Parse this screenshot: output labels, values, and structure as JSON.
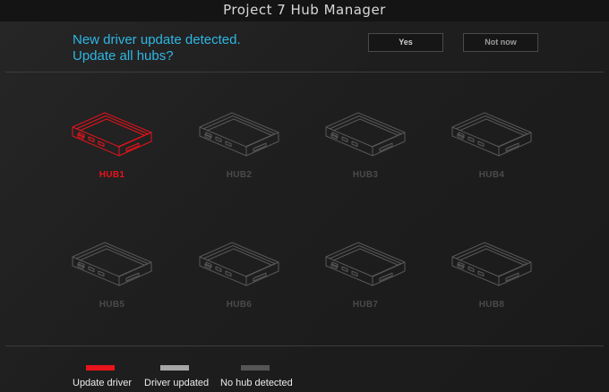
{
  "window": {
    "title": "Project 7 Hub Manager"
  },
  "prompt": {
    "line1": "New driver update detected.",
    "line2": "Update all hubs?",
    "yes_label": "Yes",
    "not_now_label": "Not now"
  },
  "hubs": [
    {
      "label": "HUB1",
      "status": "update"
    },
    {
      "label": "HUB2",
      "status": "none"
    },
    {
      "label": "HUB3",
      "status": "none"
    },
    {
      "label": "HUB4",
      "status": "none"
    },
    {
      "label": "HUB5",
      "status": "none"
    },
    {
      "label": "HUB6",
      "status": "none"
    },
    {
      "label": "HUB7",
      "status": "none"
    },
    {
      "label": "HUB8",
      "status": "none"
    }
  ],
  "legend": [
    {
      "label": "Update driver",
      "color": "#e8131b"
    },
    {
      "label": "Driver updated",
      "color": "#a6a6a6"
    },
    {
      "label": "No hub detected",
      "color": "#555555"
    }
  ],
  "colors": {
    "accent_text": "#2fb6e4",
    "update": "#e8131b",
    "update_label": "#e8131b",
    "none_stroke": "#585858",
    "none_label": "#4a4a4a"
  },
  "icons": {
    "hub": "usb-hub-icon"
  }
}
